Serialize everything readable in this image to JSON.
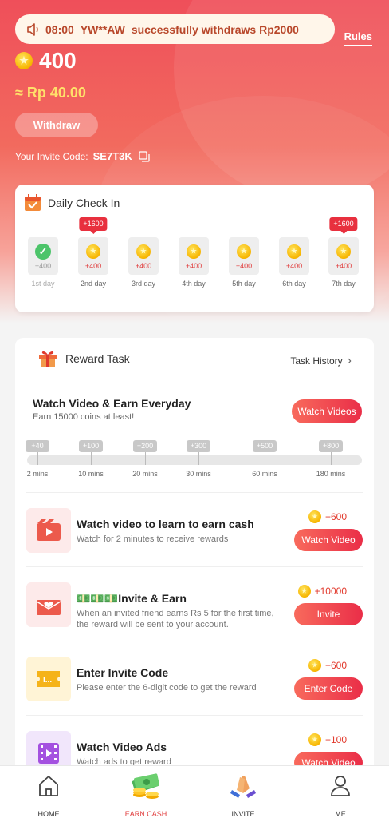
{
  "header": {
    "notice": {
      "time": "08:00",
      "user": "YW**AW",
      "message": "successfully withdraws Rp2000"
    },
    "rules_label": "Rules",
    "coins": "400",
    "rupiah": "≈ Rp 40.00",
    "withdraw_label": "Withdraw",
    "invite_code_label": "Your Invite Code:",
    "invite_code": "SE7T3K"
  },
  "checkin": {
    "title": "Daily Check In",
    "days": [
      {
        "label": "1st day",
        "amount": "+400",
        "done": true,
        "bonus": ""
      },
      {
        "label": "2nd day",
        "amount": "+400",
        "done": false,
        "bonus": "+1600"
      },
      {
        "label": "3rd day",
        "amount": "+400",
        "done": false,
        "bonus": ""
      },
      {
        "label": "4th day",
        "amount": "+400",
        "done": false,
        "bonus": ""
      },
      {
        "label": "5th day",
        "amount": "+400",
        "done": false,
        "bonus": ""
      },
      {
        "label": "6th day",
        "amount": "+400",
        "done": false,
        "bonus": ""
      },
      {
        "label": "7th day",
        "amount": "+400",
        "done": false,
        "bonus": "+1600"
      }
    ]
  },
  "tasks": {
    "title": "Reward Task",
    "history_label": "Task History",
    "watch_everyday": {
      "title": "Watch Video & Earn Everyday",
      "subtitle": "Earn 15000 coins at least!",
      "button": "Watch Videos",
      "milestones": [
        {
          "reward": "+40",
          "time": "2 mins"
        },
        {
          "reward": "+100",
          "time": "10 mins"
        },
        {
          "reward": "+200",
          "time": "20 mins"
        },
        {
          "reward": "+300",
          "time": "30 mins"
        },
        {
          "reward": "+500",
          "time": "60 mins"
        },
        {
          "reward": "+800",
          "time": "180 mins"
        }
      ]
    },
    "items": [
      {
        "title": "Watch video to learn to earn cash",
        "desc": "Watch for 2 minutes to receive rewards",
        "reward": "+600",
        "button": "Watch Video",
        "icon": "video-play-icon",
        "color": "#fdeaea"
      },
      {
        "title": "💵💵💵Invite & Earn",
        "desc": "When an invited friend earns Rs 5 for the first time, the reward will be sent to your account.",
        "reward": "+10000",
        "button": "Invite",
        "icon": "envelope-heart-icon",
        "color": "#fdeaea"
      },
      {
        "title": "Enter Invite Code",
        "desc": "Please enter the 6-digit code to get the reward",
        "reward": "+600",
        "button": "Enter Code",
        "icon": "ticket-icon",
        "color": "#fff4d6"
      },
      {
        "title": "Watch Video Ads",
        "desc": "Watch ads to get reward",
        "reward": "+100",
        "button": "Watch Video",
        "icon": "film-icon",
        "color": "#f1e6fb"
      }
    ]
  },
  "nav": [
    {
      "label": "HOME",
      "icon": "home-icon",
      "active": false
    },
    {
      "label": "EARN CASH",
      "icon": "cash-coins-icon",
      "active": true
    },
    {
      "label": "INVITE",
      "icon": "invite-hands-icon",
      "active": false
    },
    {
      "label": "ME",
      "icon": "person-icon",
      "active": false
    }
  ]
}
